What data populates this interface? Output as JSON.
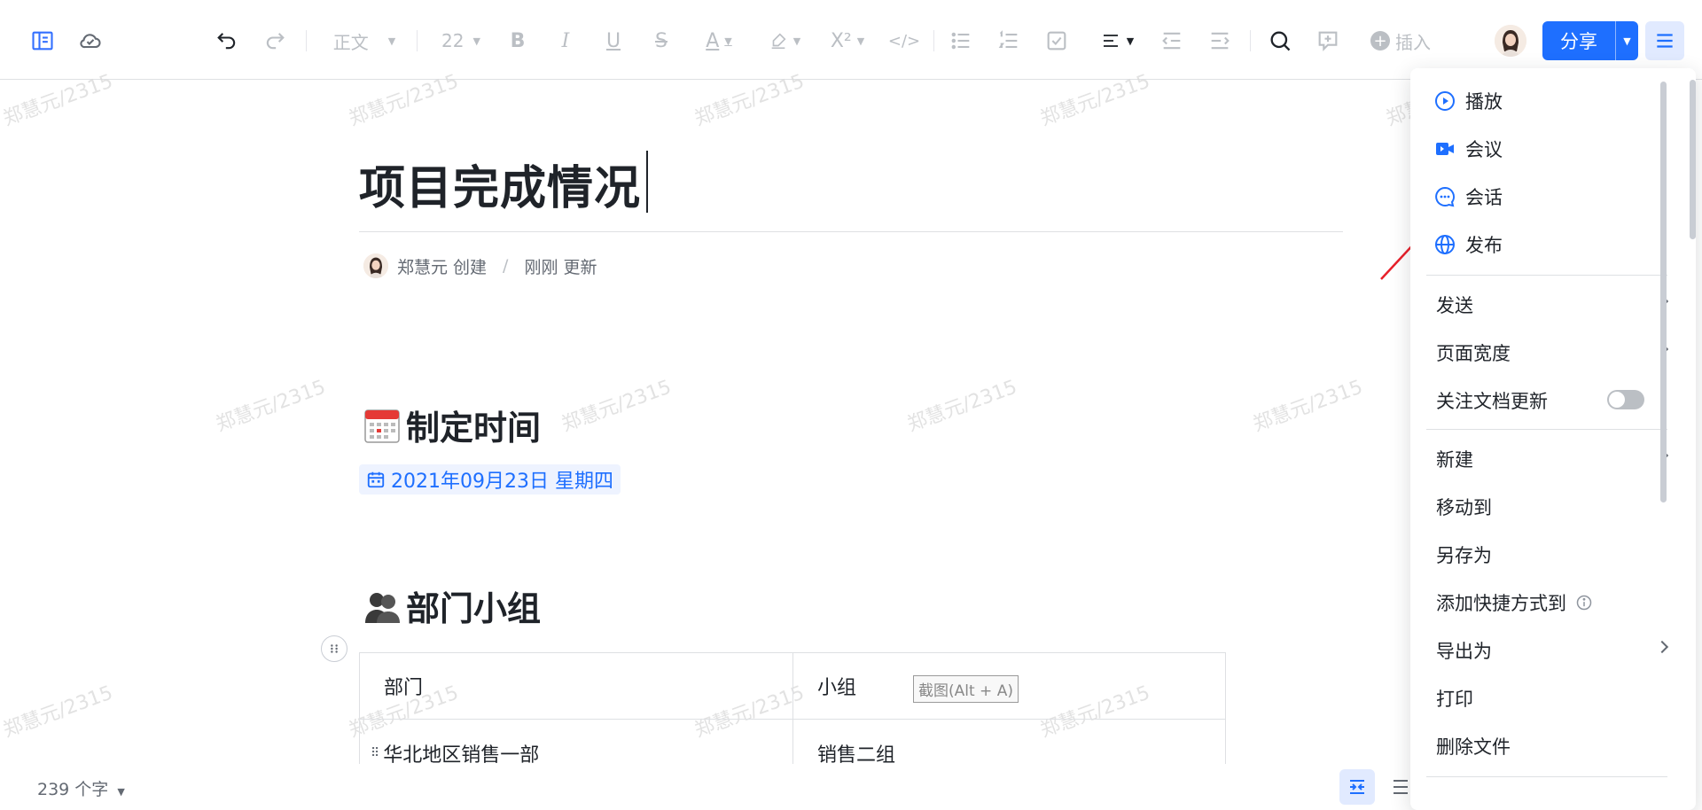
{
  "toolbar": {
    "style_select": "正文",
    "font_size": "22",
    "insert_label": "插入",
    "share_label": "分享"
  },
  "watermark": "郑慧元/2315",
  "document": {
    "title": "项目完成情况",
    "meta": {
      "creator": "郑慧元 创建",
      "separator": "/",
      "updated": "刚刚 更新"
    },
    "section1": {
      "heading": "制定时间",
      "date": "2021年09月23日 星期四"
    },
    "section2": {
      "heading": "部门小组",
      "table": {
        "header": [
          "部门",
          "小组"
        ],
        "rows": [
          [
            "华北地区销售一部",
            "销售二组"
          ]
        ]
      }
    },
    "tooltip": "截图(Alt + A)"
  },
  "footer": {
    "word_count": "239 个字"
  },
  "menu": {
    "items_top": [
      {
        "label": "播放",
        "icon": "play-icon"
      },
      {
        "label": "会议",
        "icon": "video-icon"
      },
      {
        "label": "会话",
        "icon": "chat-icon"
      },
      {
        "label": "发布",
        "icon": "globe-icon"
      }
    ],
    "send": "发送",
    "page_width": "页面宽度",
    "follow_updates": "关注文档更新",
    "new": "新建",
    "move_to": "移动到",
    "save_as": "另存为",
    "add_shortcut": "添加快捷方式到",
    "export_as": "导出为",
    "print": "打印",
    "delete_file": "删除文件"
  },
  "colors": {
    "accent": "#1e6fff",
    "highlight": "#e8202a"
  }
}
